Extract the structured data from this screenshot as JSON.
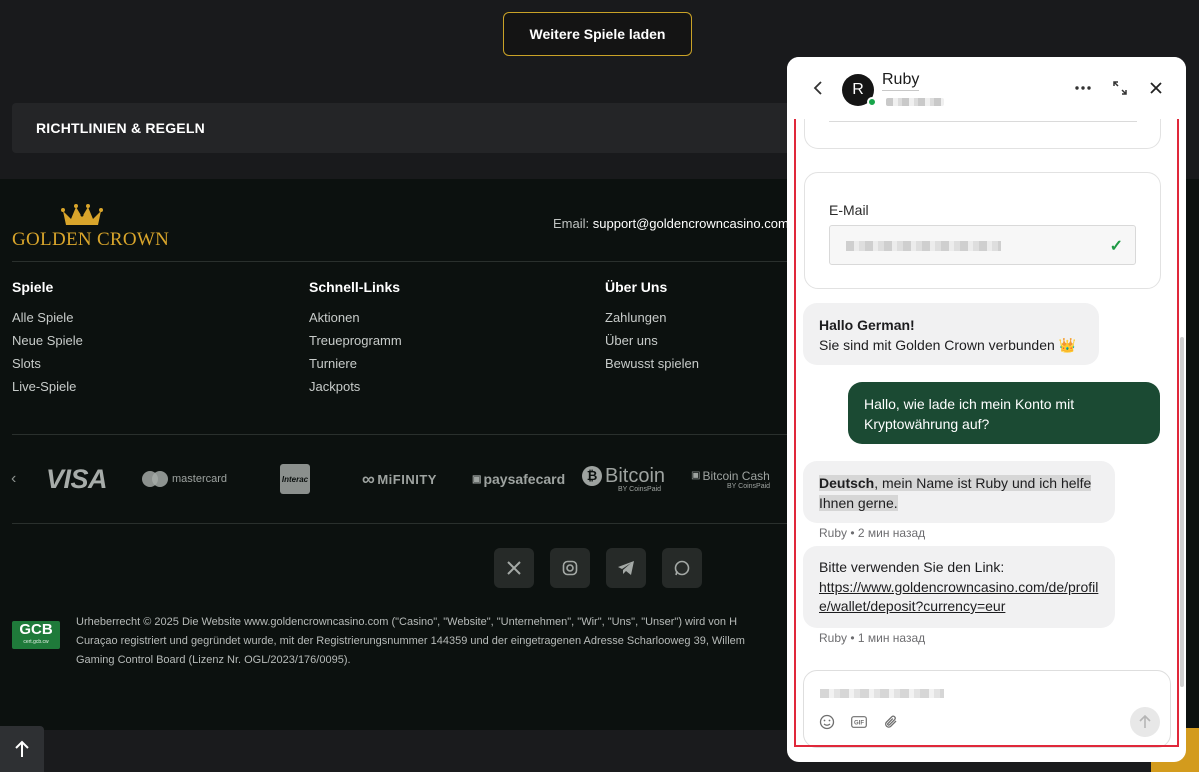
{
  "top": {
    "load_more": "Weitere Spiele laden",
    "rules_title": "RICHTLINIEN & REGELN"
  },
  "footer": {
    "brand": "GOLDEN CROWN",
    "email_label": "Email:",
    "email_value": "support@goldencrowncasino.com",
    "columns": [
      {
        "title": "Spiele",
        "links": [
          "Alle Spiele",
          "Neue Spiele",
          "Slots",
          "Live-Spiele"
        ]
      },
      {
        "title": "Schnell-Links",
        "links": [
          "Aktionen",
          "Treueprogramm",
          "Turniere",
          "Jackpots"
        ]
      },
      {
        "title": "Über Uns",
        "links": [
          "Zahlungen",
          "Über uns",
          "Bewusst spielen"
        ]
      }
    ],
    "payments": [
      "VISA",
      "mastercard",
      "Interac",
      "MiFINITY",
      "paysafecard",
      "Bitcoin",
      "Bitcoin Cash"
    ],
    "payment_sub": "BY CoinsPaid",
    "socials": [
      "x-icon",
      "instagram-icon",
      "telegram-icon",
      "whatsapp-icon"
    ],
    "gcb_badge": "GCB",
    "gcb_sub": "cert.gcb.cw",
    "legal_lines": [
      "Urheberrecht © 2025 Die Website www.goldencrowncasino.com (\"Casino\", \"Website\", \"Unternehmen\", \"Wir\", \"Uns\", \"Unser\") wird von H",
      "Curaçao registriert und gegründet wurde, mit der Registrierungsnummer 144359 und der eingetragenen Adresse Scharlooweg 39, Willem",
      "Gaming Control Board (Lizenz Nr. OGL/2023/176/0095)."
    ]
  },
  "chat": {
    "agent_initial": "R",
    "agent_name": "Ruby",
    "email_label": "E-Mail",
    "messages": {
      "greet_title": "Hallo German!",
      "greet_body": "Sie sind mit Golden Crown verbunden 👑",
      "user_msg": "Hallo, wie lade ich mein Konto mit Kryptowährung auf?",
      "reply1_bold": "Deutsch",
      "reply1_rest": ", mein Name ist Ruby und ich helfe Ihnen gerne.",
      "reply1_meta": "Ruby • 2 мин назад",
      "reply2_text": "Bitte verwenden Sie den Link:",
      "reply2_link": "https://www.goldencrowncasino.com/de/profile/wallet/deposit?currency=eur",
      "reply2_meta": "Ruby • 1 мин назад"
    }
  },
  "colors": {
    "accent_gold": "#c9a227",
    "chat_user_bubble": "#1b4a33",
    "online": "#17a54a",
    "highlight_frame": "#e0283a"
  }
}
